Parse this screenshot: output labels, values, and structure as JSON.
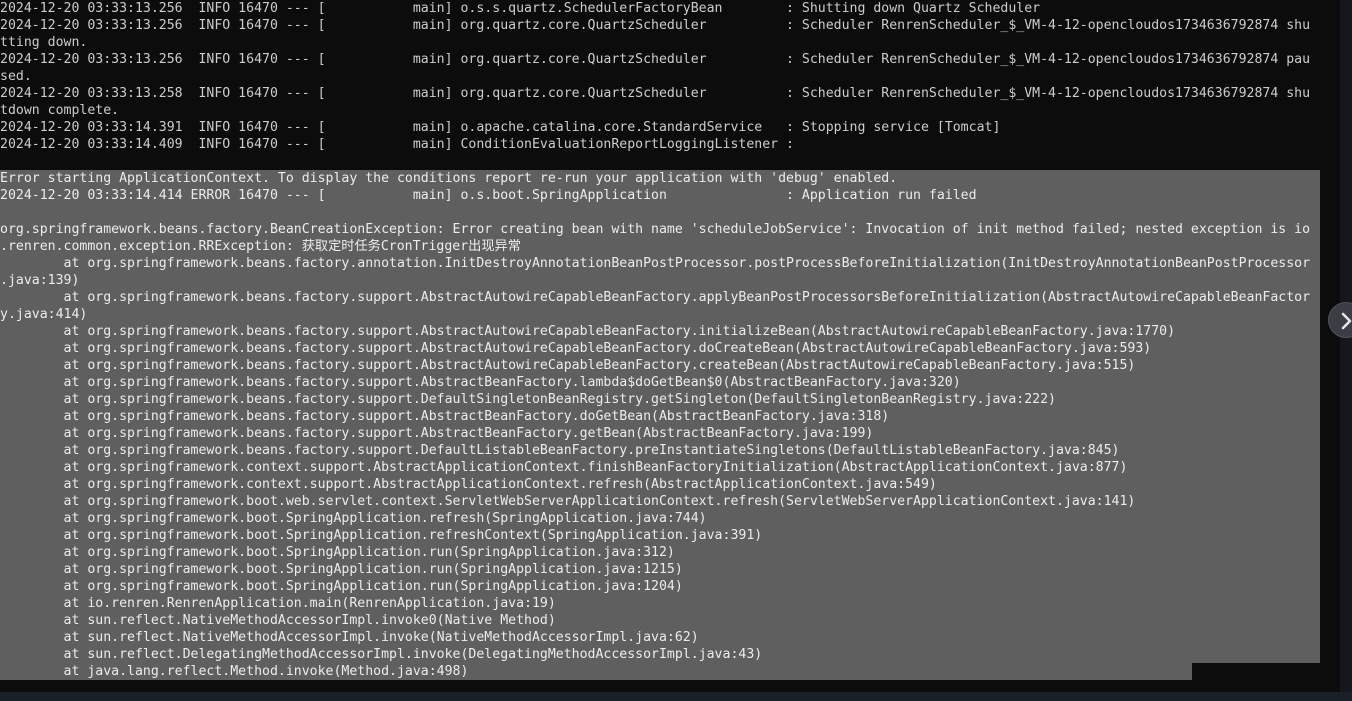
{
  "terminal": {
    "icons": {
      "side_toggle": "chevron-right-icon"
    },
    "colors": {
      "background": "#0c0c0c",
      "text": "#cccccc",
      "selection_background": "#5f5f5f"
    },
    "lines": [
      {
        "text": "2024-12-20 03:33:13.256  INFO 16470 --- [           main] o.s.s.quartz.SchedulerFactoryBean        : Shutting down Quartz Scheduler",
        "selected": false
      },
      {
        "text": "2024-12-20 03:33:13.256  INFO 16470 --- [           main] org.quartz.core.QuartzScheduler          : Scheduler RenrenScheduler_$_VM-4-12-opencloudos1734636792874 shu",
        "selected": false
      },
      {
        "text": "tting down.",
        "selected": false
      },
      {
        "text": "2024-12-20 03:33:13.256  INFO 16470 --- [           main] org.quartz.core.QuartzScheduler          : Scheduler RenrenScheduler_$_VM-4-12-opencloudos1734636792874 pau",
        "selected": false
      },
      {
        "text": "sed.",
        "selected": false
      },
      {
        "text": "2024-12-20 03:33:13.258  INFO 16470 --- [           main] org.quartz.core.QuartzScheduler          : Scheduler RenrenScheduler_$_VM-4-12-opencloudos1734636792874 shu",
        "selected": false
      },
      {
        "text": "tdown complete.",
        "selected": false
      },
      {
        "text": "2024-12-20 03:33:14.391  INFO 16470 --- [           main] o.apache.catalina.core.StandardService   : Stopping service [Tomcat]",
        "selected": false
      },
      {
        "text": "2024-12-20 03:33:14.409  INFO 16470 --- [           main] ConditionEvaluationReportLoggingListener :",
        "selected": false
      },
      {
        "text": "",
        "selected": false
      },
      {
        "text": "Error starting ApplicationContext. To display the conditions report re-run your application with 'debug' enabled.",
        "selected": true
      },
      {
        "text": "2024-12-20 03:33:14.414 ERROR 16470 --- [           main] o.s.boot.SpringApplication               : Application run failed",
        "selected": true
      },
      {
        "text": "",
        "selected": true
      },
      {
        "text": "org.springframework.beans.factory.BeanCreationException: Error creating bean with name 'scheduleJobService': Invocation of init method failed; nested exception is io",
        "selected": true
      },
      {
        "text": ".renren.common.exception.RRException: 获取定时任务CronTrigger出现异常",
        "selected": true
      },
      {
        "text": "        at org.springframework.beans.factory.annotation.InitDestroyAnnotationBeanPostProcessor.postProcessBeforeInitialization(InitDestroyAnnotationBeanPostProcessor",
        "selected": true
      },
      {
        "text": ".java:139)",
        "selected": true
      },
      {
        "text": "        at org.springframework.beans.factory.support.AbstractAutowireCapableBeanFactory.applyBeanPostProcessorsBeforeInitialization(AbstractAutowireCapableBeanFactor",
        "selected": true
      },
      {
        "text": "y.java:414)",
        "selected": true
      },
      {
        "text": "        at org.springframework.beans.factory.support.AbstractAutowireCapableBeanFactory.initializeBean(AbstractAutowireCapableBeanFactory.java:1770)",
        "selected": true
      },
      {
        "text": "        at org.springframework.beans.factory.support.AbstractAutowireCapableBeanFactory.doCreateBean(AbstractAutowireCapableBeanFactory.java:593)",
        "selected": true
      },
      {
        "text": "        at org.springframework.beans.factory.support.AbstractAutowireCapableBeanFactory.createBean(AbstractAutowireCapableBeanFactory.java:515)",
        "selected": true
      },
      {
        "text": "        at org.springframework.beans.factory.support.AbstractBeanFactory.lambda$doGetBean$0(AbstractBeanFactory.java:320)",
        "selected": true
      },
      {
        "text": "        at org.springframework.beans.factory.support.DefaultSingletonBeanRegistry.getSingleton(DefaultSingletonBeanRegistry.java:222)",
        "selected": true
      },
      {
        "text": "        at org.springframework.beans.factory.support.AbstractBeanFactory.doGetBean(AbstractBeanFactory.java:318)",
        "selected": true
      },
      {
        "text": "        at org.springframework.beans.factory.support.AbstractBeanFactory.getBean(AbstractBeanFactory.java:199)",
        "selected": true
      },
      {
        "text": "        at org.springframework.beans.factory.support.DefaultListableBeanFactory.preInstantiateSingletons(DefaultListableBeanFactory.java:845)",
        "selected": true
      },
      {
        "text": "        at org.springframework.context.support.AbstractApplicationContext.finishBeanFactoryInitialization(AbstractApplicationContext.java:877)",
        "selected": true
      },
      {
        "text": "        at org.springframework.context.support.AbstractApplicationContext.refresh(AbstractApplicationContext.java:549)",
        "selected": true
      },
      {
        "text": "        at org.springframework.boot.web.servlet.context.ServletWebServerApplicationContext.refresh(ServletWebServerApplicationContext.java:141)",
        "selected": true
      },
      {
        "text": "        at org.springframework.boot.SpringApplication.refresh(SpringApplication.java:744)",
        "selected": true
      },
      {
        "text": "        at org.springframework.boot.SpringApplication.refreshContext(SpringApplication.java:391)",
        "selected": true
      },
      {
        "text": "        at org.springframework.boot.SpringApplication.run(SpringApplication.java:312)",
        "selected": true
      },
      {
        "text": "        at org.springframework.boot.SpringApplication.run(SpringApplication.java:1215)",
        "selected": true
      },
      {
        "text": "        at org.springframework.boot.SpringApplication.run(SpringApplication.java:1204)",
        "selected": true
      },
      {
        "text": "        at io.renren.RenrenApplication.main(RenrenApplication.java:19)",
        "selected": true
      },
      {
        "text": "        at sun.reflect.NativeMethodAccessorImpl.invoke0(Native Method)",
        "selected": true
      },
      {
        "text": "        at sun.reflect.NativeMethodAccessorImpl.invoke(NativeMethodAccessorImpl.java:62)",
        "selected": true
      },
      {
        "text": "        at sun.reflect.DelegatingMethodAccessorImpl.invoke(DelegatingMethodAccessorImpl.java:43)",
        "selected": true
      },
      {
        "text": "        at java.lang.reflect.Method.invoke(Method.java:498)",
        "selected": "partial"
      }
    ]
  }
}
